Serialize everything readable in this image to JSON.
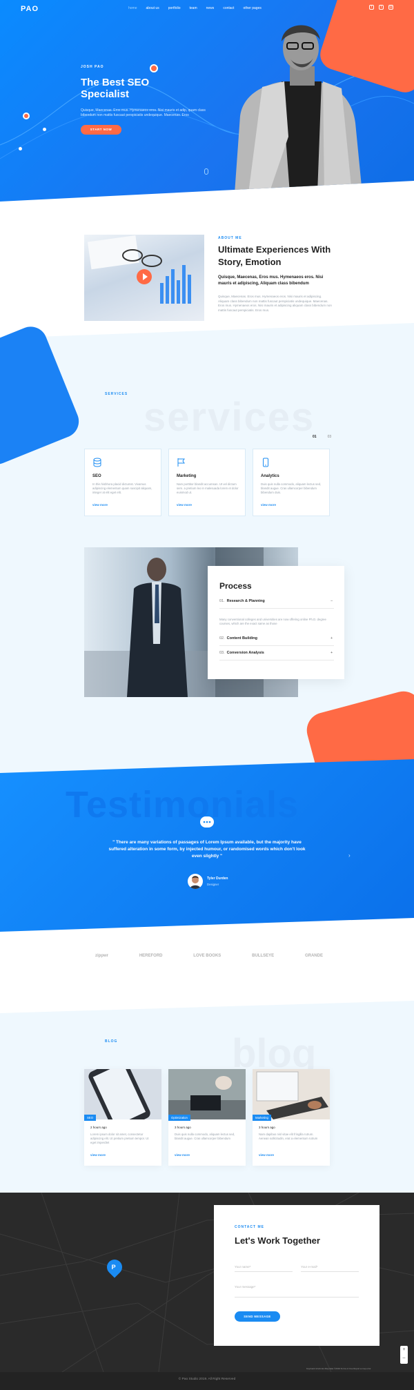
{
  "brand": {
    "logo": "PAO"
  },
  "nav": {
    "items": [
      "home",
      "about us",
      "portfolio",
      "team",
      "news",
      "contact",
      "other pages"
    ]
  },
  "social": [
    "facebook",
    "twitter",
    "instagram"
  ],
  "hero": {
    "kicker": "JOSH PAO",
    "title": "The Best SEO Specialist",
    "text": "Quisque, Maecenas. Eros mus. Hymenaeos eros. Nisi mauris et adip, quam class bibendum non mattis fuscaut perspiciatis undequique. Maecenas. Eros",
    "button": "START NOW"
  },
  "about": {
    "kicker": "ABOUT ME",
    "title": "Ultimate Experiences With Story, Emotion",
    "subtitle": "Quisque, Maecenas, Eros mus. Hymenaeos eros. Nisi mauris et adipiscing, Aliquam class bibendum",
    "body": "Quisque, Maecenas. Eros mus. Hymenaeos eros. Nisi mauris et adipiscing. Aliquam class bibendum non mattis fuscaut perspiciatis undequique. Maecenas. Eros mus. Hymenaeos eros. Nisi mauris et adipiscing aliquam class bibendum non mattis fuscaut perspiciatis. Eros mus."
  },
  "services": {
    "kicker": "SERVICES",
    "watermark": "services",
    "pager": [
      "01",
      "03"
    ],
    "cards": [
      {
        "title": "SEO",
        "desc": "In this hisbhora placid dictumst. Vivamus adipiscing elementum quam suscipit aliquam, integer at elit eget elit.",
        "more": "view more",
        "icon": "database-icon"
      },
      {
        "title": "Marketing",
        "desc": "Nam porttitor blandit accumsan. Ut vel dictum sem. a pretium leo in malesuada lorem et dolor euismod ut.",
        "more": "view more",
        "icon": "flag-icon"
      },
      {
        "title": "Analytics",
        "desc": "Duis quis nulla commodo, aliquam lectus sed, blandit augue. Cras ullamcorper bibendum bibendum duis.",
        "more": "view more",
        "icon": "smartphone-icon"
      }
    ]
  },
  "process": {
    "title": "Process",
    "items": [
      {
        "num": "01.",
        "label": "Research & Planning",
        "arrow": "–"
      },
      {
        "num": "02.",
        "label": "Content Building",
        "arrow": "+"
      },
      {
        "num": "03.",
        "label": "Conversion Analysis",
        "arrow": "+"
      }
    ],
    "desc": "Many conventional colleges and universities are now offering online Ph.D. degree courses, which are the exact same as those"
  },
  "testimonials": {
    "watermark": "Testimonials",
    "quote": "\" There are many variations of passages of Lorem Ipsum available, but the majority have suffered alteration in some form, by injected humour, or randomised words which don't look even slightly \"",
    "author": "Tyler Durden",
    "role": "Designer"
  },
  "clients": [
    "zippwr",
    "HEREFORD",
    "LOVE BOOKS",
    "BULLSEYE",
    "GRANDE"
  ],
  "blog": {
    "kicker": "BLOG",
    "watermark": "blog",
    "posts": [
      {
        "tag": "SEO",
        "time": "2 hours ago",
        "excerpt": "Lorem ipsum dolor sit amet, consectetur adipiscing elit. Ut pretium pretium tempor. Ut eget imperdiet",
        "more": "view more"
      },
      {
        "tag": "Optimization",
        "time": "3 hours ago",
        "excerpt": "Duis quis nulla commodo, aliquam lectus sed, blandit augue. Cras ullamcorper bibendum",
        "more": "view more"
      },
      {
        "tag": "Marketing",
        "time": "3 hours ago",
        "excerpt": "Nam dapibus nisl vitae elit fringilla rutrum. Aenean sollicitudin, erat a elementum rutrum",
        "more": "view more"
      }
    ]
  },
  "contact": {
    "kicker": "CONTACT ME",
    "title": "Let's Work Together",
    "name_placeholder": "Your name*",
    "email_placeholder": "Your e-mail*",
    "message_placeholder": "Your message*",
    "button": "SEND MESSAGE",
    "map_zoom": [
      "+",
      "–"
    ],
    "map_attribution": "Keyboard shortcuts   Map data ©2019   Terms of Use   Report a map error"
  },
  "footer": {
    "copyright": "© Pao Studio 2019. All Right Reserved"
  },
  "colors": {
    "primary": "#1a8bf2",
    "accent": "#ff6a45",
    "light": "#eff8fe",
    "dark": "#2a2a2a"
  }
}
